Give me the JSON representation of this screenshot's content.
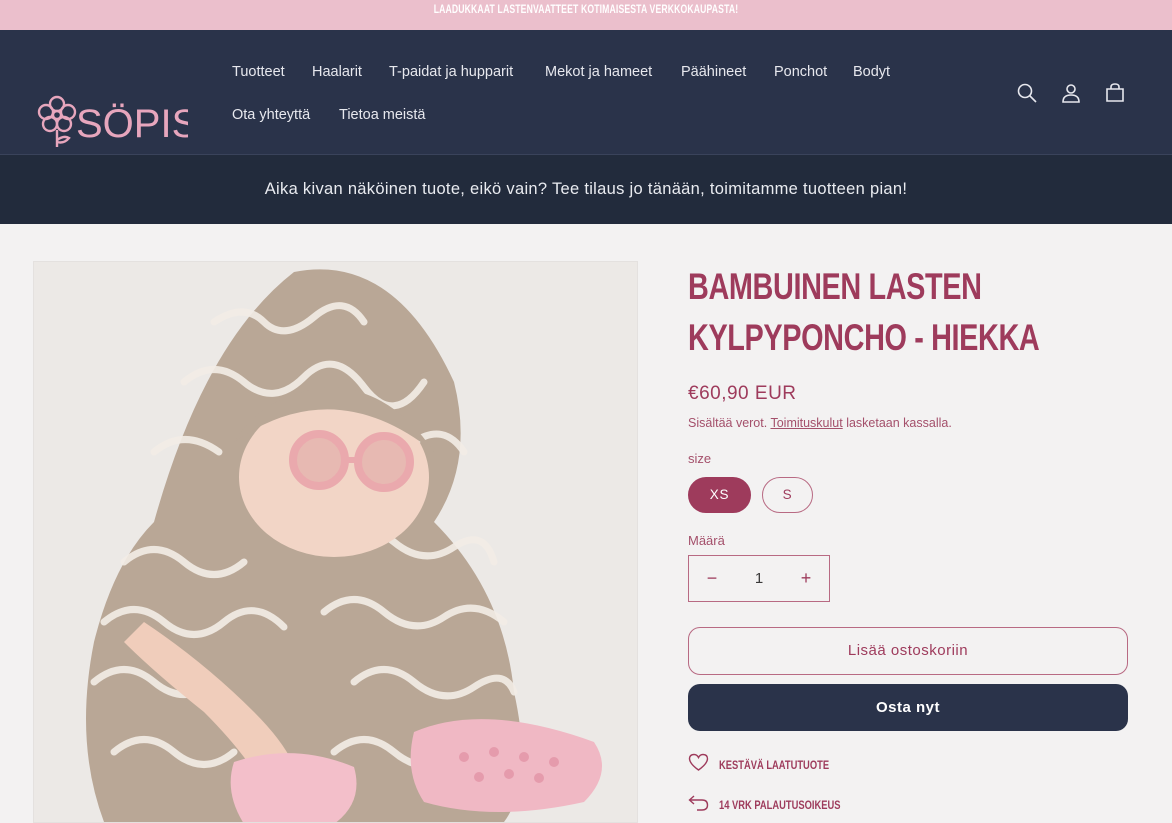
{
  "announcement": "Laadukkaat lastenvaatteet kotimaisesta verkkokaupasta!",
  "logo": {
    "text": "SÖPIS"
  },
  "nav": [
    "Tuotteet",
    "Haalarit",
    "T-paidat ja hupparit",
    "Mekot ja hameet",
    "Päähineet",
    "Ponchot",
    "Bodyt",
    "Ota yhteyttä",
    "Tietoa meistä"
  ],
  "icons": {
    "search": "search-icon",
    "account": "account-icon",
    "cart": "cart-icon"
  },
  "promo": "Aika kivan näköinen tuote, eikö vain? Tee tilaus jo tänään, toimitamme tuotteen pian!",
  "product": {
    "title": "Bambuinen lasten kylpyponcho - Hiekka",
    "price": "€60,90 EUR",
    "tax_prefix": "Sisältää verot.",
    "tax_link": "Toimituskulut",
    "tax_suffix": "lasketaan kassalla.",
    "size_label": "size",
    "sizes": [
      "XS",
      "S"
    ],
    "selected_size": "XS",
    "quantity_label": "Määrä",
    "quantity": "1",
    "add_to_cart": "Lisää ostoskoriin",
    "buy_now": "Osta nyt",
    "features": [
      "Kestävä laatutuote",
      "14 vrk palautusoikeus"
    ]
  },
  "colors": {
    "brand": "#9e3b5c",
    "header_bg": "#2a334a",
    "promo_bg": "#222b3c",
    "announcement_bg": "#ebbfcc",
    "page_bg": "#f3f2f2"
  }
}
